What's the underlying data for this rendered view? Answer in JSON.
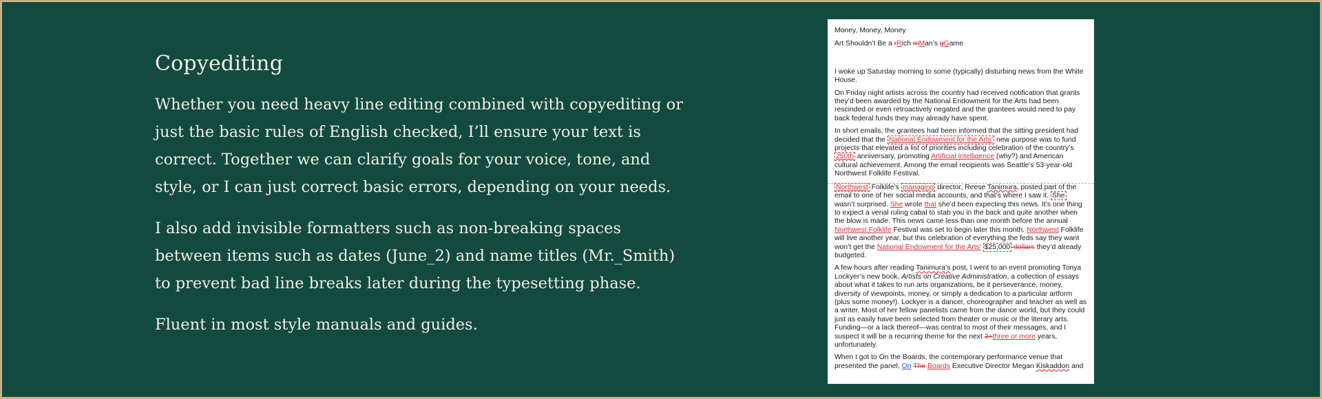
{
  "section": {
    "heading": "Copyediting",
    "paragraphs": [
      "Whether you need heavy line editing combined with copyediting or just the basic rules of English checked, I’ll ensure your text is correct. Together we can clarify goals for your voice, tone, and style, or I can just correct basic errors, depending on your needs.",
      "I also add invisible formatters such as non-breaking spaces between items such as dates (June_2) and name titles (Mr._Smith) to prevent bad line breaks later during the typesetting phase.",
      "Fluent in most style manuals and guides."
    ]
  },
  "doc": {
    "title1": "Money, Money, Money",
    "title2_a": "Art Shouldn’t Be a ",
    "title2_r_del": "r",
    "title2_r_ins": "R",
    "title2_b": "ich ",
    "title2_m_del": "m",
    "title2_m_ins": "M",
    "title2_c": "an’s ",
    "title2_g_del": "g",
    "title2_g_ins": "G",
    "title2_d": "ame",
    "p1": "I woke up Saturday morning to some (typically) disturbing news from the White House.",
    "p2": "On Friday night artists across the country had received notification that grants they’d been awarded by the National Endowment for the Arts had been rescinded or even retroactively negated and the grantees would need to pay back federal funds they may already have spent.",
    "p3_a": "In short emails, the grantees had been informed that the sitting president had decided that the ",
    "p3_nea": "National Endowment for the Arts’",
    "p3_b": " new purpose was to fund projects that elevated a list of priorities including celebration of the country’s ",
    "p3_250": "250th",
    "p3_c": " anniversary, promoting ",
    "p3_ai": "Artificial Intelligence",
    "p3_d": " (why?) and American cultural achievement. Among the email recipients was Seattle’s 53-year-old Northwest Folklife Festival.",
    "p4_nw": "Northwest",
    "p4_a": " Folklife’s ",
    "p4_managing": "managing",
    "p4_b": " director, Reese ",
    "p4_tan": "Tanimura",
    "p4_c": ", posted part of the email to one of her social media accounts, and that’s where I saw it. ",
    "p4_she": "She",
    "p4_d": " wasn’t surprised. ",
    "p4_she2": "She",
    "p4_e": " wrote ",
    "p4_that": "that",
    "p4_f": " she’d been expecting this news. It’s one thing to expect a venal ruling cabal to stab you in the back and quite another when the blow is made. This news came less than one month before the annual ",
    "p4_nwf": "Northwest Folklife",
    "p4_g": " Festival was set to begin later this month. ",
    "p4_nw2": "Northwest",
    "p4_h": " Folklife will live another year, but this celebration of everything the feds say they want won’t get the ",
    "p4_nea2": "National Endowment for the Arts’",
    "p4_i": " ",
    "p4_money": "$25,000",
    "p4_dollars": " dollars",
    "p4_j": " they’d already budgeted.",
    "p5_a": "A few hours after reading ",
    "p5_tan": "Tanimura’s",
    "p5_b": " post, I went to an event promoting Tonya Lockyer’s new book, ",
    "p5_book": "Artists on Creative Administration",
    "p5_c": ", a collection of essays about what it takes to run arts organizations, be it perseverance, money, diversity of viewpoints, money, or simply a dedication to a particular artform (plus some money!). Lockyer is a dancer, choreographer and teacher as well as a writer. Most of her fellow panelists came from the dance world, but they could just as easily have been selected from theater or music or the literary arts. Funding—or a lack thereof—was central to most of their messages, and I suspect it will be a recurring theme for the next ",
    "p5_del": "3+",
    "p5_ins": "three or more",
    "p5_d": " years, unfortunately.",
    "p6_a": "When I got to On the Boards, the contemporary performance venue that presented the panel, ",
    "p6_on": "On",
    "p6_the": "The",
    "p6_boards": "Boards",
    "p6_b": " Executive Director Megan ",
    "p6_kisk": "Kiskaddon",
    "p6_c": " and"
  },
  "colors": {
    "background": "#134a40",
    "border": "#c8b28a",
    "edit": "#d0343a"
  }
}
